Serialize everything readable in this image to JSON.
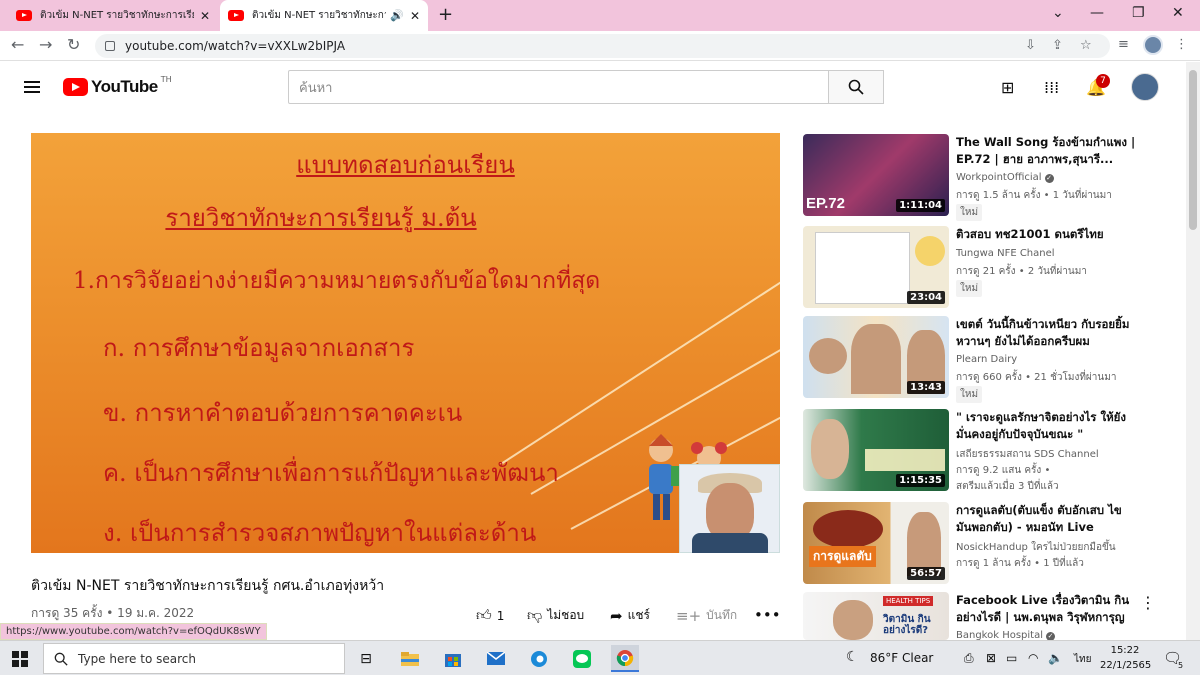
{
  "browser": {
    "tabs": [
      {
        "title": "ติวเข้ม N-NET รายวิชาทักษะการเรียนรู้"
      },
      {
        "title": "ติวเข้ม N-NET รายวิชาทักษะการเรียนรู้"
      }
    ],
    "url": "youtube.com/watch?v=vXXLw2bIPJA",
    "status_url": "https://www.youtube.com/watch?v=efOQdUK8sWY"
  },
  "youtube": {
    "logo_text": "YouTube",
    "region": "TH",
    "search_placeholder": "ค้นหา",
    "notification_count": "7"
  },
  "player": {
    "slide_lines": [
      "แบบทดสอบก่อนเรียน",
      "รายวิชาทักษะการเรียนรู้ ม.ต้น",
      "1.การวิจัยอย่างง่ายมีความหมายตรงกับข้อใดมากที่สุด",
      "ก. การศึกษาข้อมูลจากเอกสาร",
      "ข. การหาคำตอบด้วยการคาดคะเน",
      "ค. เป็นการศึกษาเพื่อการแก้ปัญหาและพัฒนา",
      "ง. เป็นการสำรวจสภาพปัญหาในแต่ละด้าน"
    ]
  },
  "video": {
    "title": "ติวเข้ม N-NET รายวิชาทักษะการเรียนรู้ กศน.อำเภอทุ่งหว้า",
    "meta": "การดู 35 ครั้ง • 19 ม.ค. 2022",
    "like_count": "1",
    "dislike_label": "ไม่ชอบ",
    "share_label": "แชร์",
    "save_label": "บันทึก"
  },
  "related": [
    {
      "title": "The Wall Song ร้องข้ามกำแพง | EP.72 | ฮาย อาภาพร,สุนารี...",
      "channel": "WorkpointOfficial",
      "meta": "การดู 1.5 ล้าน ครั้ง • 1 วันที่ผ่านมา",
      "badge": "ใหม่",
      "duration": "1:11:04",
      "thumb_text": "EP.72"
    },
    {
      "title": "ติวสอบ ทช21001 ดนตรีไทย",
      "channel": "Tungwa NFE Chanel",
      "meta": "การดู 21 ครั้ง • 2 วันที่ผ่านมา",
      "badge": "ใหม่",
      "duration": "23:04"
    },
    {
      "title": "เขตต์ วันนี้กินข้าวเหนียว กับรอยยิ้มหวานๆ ยังไม่ได้ออกครีบผม",
      "channel": "Plearn Dairy",
      "meta": "การดู 660 ครั้ง • 21 ชั่วโมงที่ผ่านมา",
      "badge": "ใหม่",
      "duration": "13:43"
    },
    {
      "title": "\" เราจะดูแลรักษาจิตอย่างไร ให้ยังมั่นคงอยู่กับปัจจุบันขณะ \"",
      "channel": "เสถียรธรรมสถาน SDS Channel",
      "meta": "การดู 9.2 แสน ครั้ง •",
      "meta2": "สตรีมแล้วเมื่อ 3 ปีที่แล้ว",
      "duration": "1:15:35"
    },
    {
      "title": "การดูแลตับ(ตับแข็ง ตับอักเสบ ไขมันพอกตับ) - หมอนัท Live",
      "channel": "NosickHandup ใครไม่ป่วยยกมือขึ้น",
      "meta": "การดู 1 ล้าน ครั้ง • 1 ปีที่แล้ว",
      "duration": "56:57",
      "thumb_text": "การดูแลตับ"
    },
    {
      "title": "Facebook Live เรื่องวิตามิน กินอย่างไรดี | นพ.ดนุพล วิรุฬหการุญ",
      "channel": "Bangkok Hospital",
      "thumb_text": "วิตามิน กินอย่างไรดี?"
    }
  ],
  "taskbar": {
    "search_placeholder": "Type here to search",
    "weather": "86°F  Clear",
    "lang": "ไทย",
    "time": "15:22",
    "date": "22/1/2565",
    "notif_count": "5"
  },
  "colors": {
    "tab_strip": "#f2c4dc",
    "youtube_red": "#ff0000",
    "slide_text": "#c01818",
    "slide_bg": "#ec8f2c"
  }
}
